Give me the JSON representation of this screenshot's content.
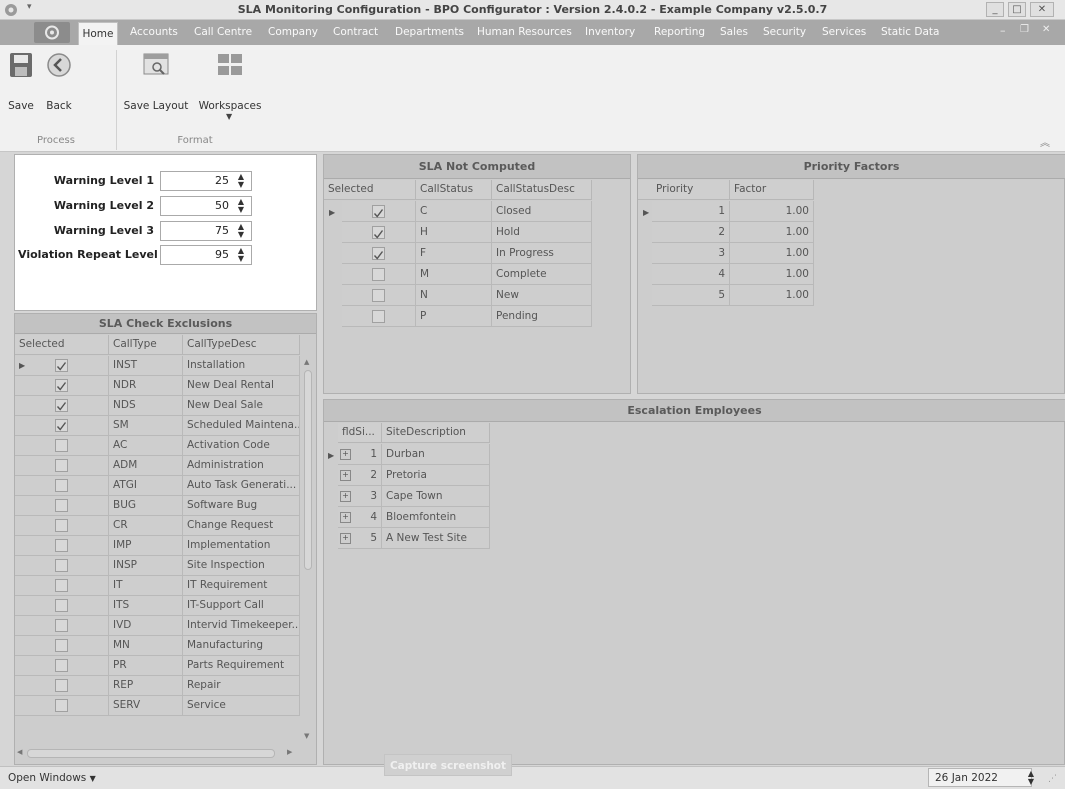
{
  "window": {
    "title": "SLA Monitoring Configuration - BPO Configurator : Version 2.4.0.2 - Example Company v2.5.0.7"
  },
  "menu": {
    "items": [
      "Home",
      "Accounts",
      "Call Centre",
      "Company",
      "Contract",
      "Departments",
      "Human Resources",
      "Inventory",
      "Reporting",
      "Sales",
      "Security",
      "Services",
      "Static Data"
    ]
  },
  "ribbon": {
    "save": "Save",
    "back": "Back",
    "save_layout": "Save Layout",
    "workspaces": "Workspaces",
    "group_process": "Process",
    "group_format": "Format"
  },
  "warnings": {
    "level1_label": "Warning Level 1",
    "level1_value": "25",
    "level2_label": "Warning Level 2",
    "level2_value": "50",
    "level3_label": "Warning Level 3",
    "level3_value": "75",
    "repeat_label": "Violation Repeat Level",
    "repeat_value": "95"
  },
  "exclusions": {
    "title": "SLA Check Exclusions",
    "columns": [
      "Selected",
      "CallType",
      "CallTypeDesc"
    ],
    "rows": [
      {
        "checked": true,
        "type": "INST",
        "desc": "Installation"
      },
      {
        "checked": true,
        "type": "NDR",
        "desc": "New Deal Rental"
      },
      {
        "checked": true,
        "type": "NDS",
        "desc": "New Deal Sale"
      },
      {
        "checked": true,
        "type": "SM",
        "desc": "Scheduled Maintena..."
      },
      {
        "checked": false,
        "type": "AC",
        "desc": "Activation Code"
      },
      {
        "checked": false,
        "type": "ADM",
        "desc": "Administration"
      },
      {
        "checked": false,
        "type": "ATGI",
        "desc": "Auto Task Generati..."
      },
      {
        "checked": false,
        "type": "BUG",
        "desc": "Software Bug"
      },
      {
        "checked": false,
        "type": "CR",
        "desc": "Change Request"
      },
      {
        "checked": false,
        "type": "IMP",
        "desc": "Implementation"
      },
      {
        "checked": false,
        "type": "INSP",
        "desc": "Site Inspection"
      },
      {
        "checked": false,
        "type": "IT",
        "desc": "IT Requirement"
      },
      {
        "checked": false,
        "type": "ITS",
        "desc": "IT-Support Call"
      },
      {
        "checked": false,
        "type": "IVD",
        "desc": "Intervid Timekeeper..."
      },
      {
        "checked": false,
        "type": "MN",
        "desc": "Manufacturing"
      },
      {
        "checked": false,
        "type": "PR",
        "desc": "Parts Requirement"
      },
      {
        "checked": false,
        "type": "REP",
        "desc": "Repair"
      },
      {
        "checked": false,
        "type": "SERV",
        "desc": "Service"
      }
    ]
  },
  "not_computed": {
    "title": "SLA Not Computed",
    "columns": [
      "Selected",
      "CallStatus",
      "CallStatusDesc"
    ],
    "rows": [
      {
        "checked": true,
        "status": "C",
        "desc": "Closed"
      },
      {
        "checked": true,
        "status": "H",
        "desc": "Hold"
      },
      {
        "checked": true,
        "status": "F",
        "desc": "In Progress"
      },
      {
        "checked": false,
        "status": "M",
        "desc": "Complete"
      },
      {
        "checked": false,
        "status": "N",
        "desc": "New"
      },
      {
        "checked": false,
        "status": "P",
        "desc": "Pending"
      }
    ]
  },
  "priority": {
    "title": "Priority Factors",
    "columns": [
      "Priority",
      "Factor"
    ],
    "rows": [
      {
        "priority": "1",
        "factor": "1.00"
      },
      {
        "priority": "2",
        "factor": "1.00"
      },
      {
        "priority": "3",
        "factor": "1.00"
      },
      {
        "priority": "4",
        "factor": "1.00"
      },
      {
        "priority": "5",
        "factor": "1.00"
      }
    ]
  },
  "escalation": {
    "title": "Escalation Employees",
    "columns": [
      "fldSi...",
      "SiteDescription"
    ],
    "rows": [
      {
        "id": "1",
        "site": "Durban"
      },
      {
        "id": "2",
        "site": "Pretoria"
      },
      {
        "id": "3",
        "site": "Cape Town"
      },
      {
        "id": "4",
        "site": "Bloemfontein"
      },
      {
        "id": "5",
        "site": "A New Test Site"
      }
    ]
  },
  "status": {
    "open_windows": "Open Windows",
    "capture": "Capture screenshot",
    "date": "26 Jan 2022"
  }
}
